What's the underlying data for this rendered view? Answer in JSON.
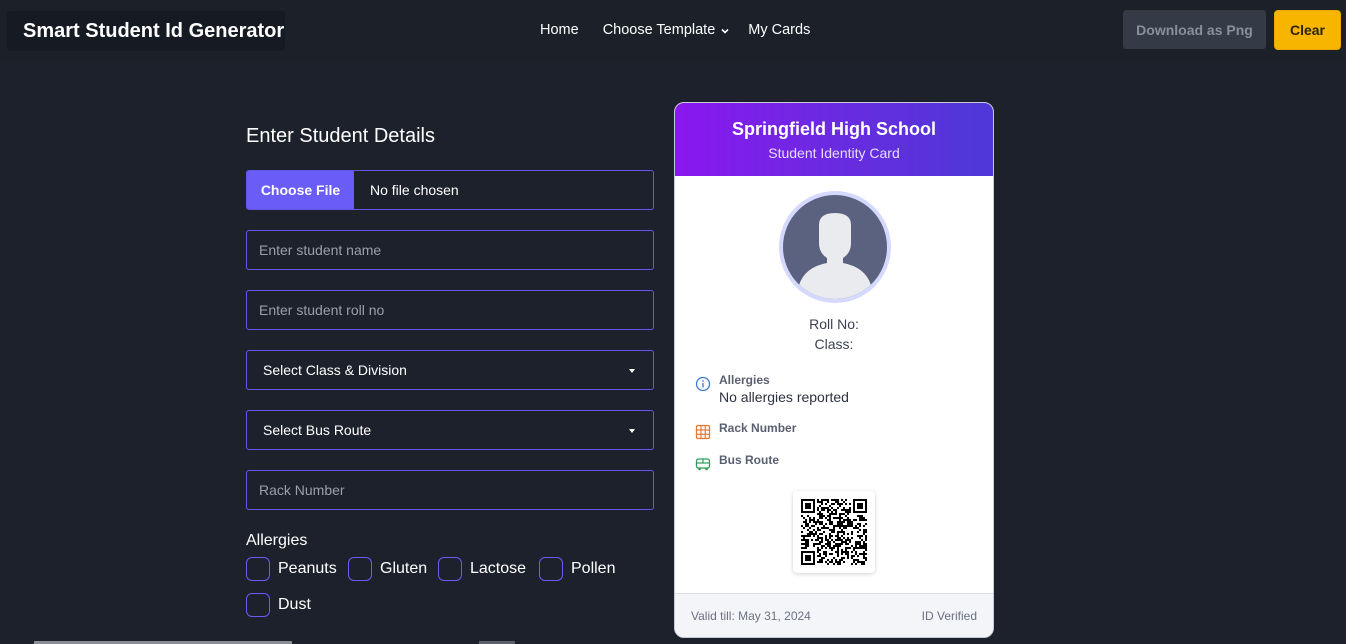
{
  "app": {
    "title": "Smart Student Id Generator"
  },
  "nav": {
    "home": "Home",
    "choose_template": "Choose Template",
    "my_cards": "My Cards"
  },
  "toolbar": {
    "download_label": "Download as Png",
    "clear_label": "Clear"
  },
  "form": {
    "title": "Enter Student Details",
    "file": {
      "button_label": "Choose File",
      "status": "No file chosen"
    },
    "name": {
      "placeholder": "Enter student name",
      "value": ""
    },
    "roll": {
      "placeholder": "Enter student roll no",
      "value": ""
    },
    "class_select": {
      "selected": "Select Class & Division"
    },
    "bus_select": {
      "selected": "Select Bus Route"
    },
    "rack": {
      "placeholder": "Rack Number",
      "value": ""
    },
    "allergies": {
      "label": "Allergies",
      "options": [
        "Peanuts",
        "Gluten",
        "Lactose",
        "Pollen",
        "Dust"
      ]
    }
  },
  "card": {
    "school": "Springfield High School",
    "subtitle": "Student Identity Card",
    "roll_label": "Roll No:",
    "class_label": "Class:",
    "allergies_title": "Allergies",
    "allergies_value": "No allergies reported",
    "rack_title": "Rack Number",
    "bus_title": "Bus Route",
    "valid_till": "Valid till: May 31, 2024",
    "verified": "ID Verified",
    "icons": {
      "allergies": "info-circle-icon",
      "rack": "grid-icon",
      "bus": "bus-icon"
    },
    "colors": {
      "header_start": "#8b17f0",
      "header_end": "#4d38d8",
      "accent": "#6a5cf6",
      "clear_button": "#f7b500"
    }
  }
}
